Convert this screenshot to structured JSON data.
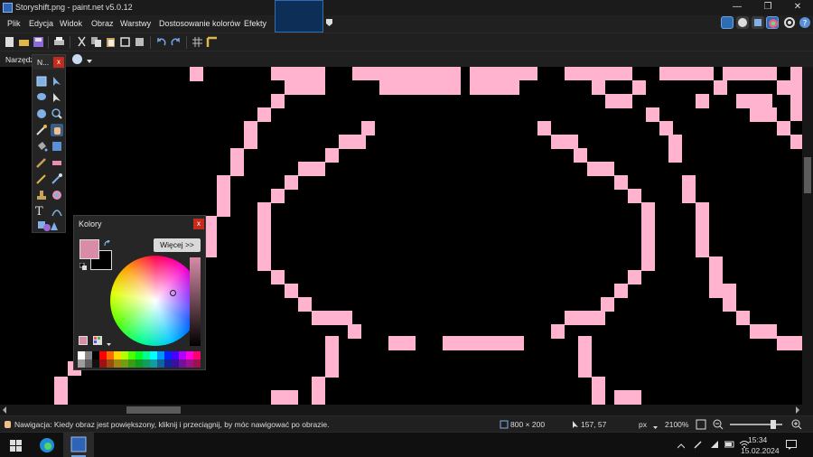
{
  "window": {
    "title": "Storyshift.png - paint.net v5.0.12",
    "min_glyph": "—",
    "max_glyph": "❐",
    "close_glyph": "✕"
  },
  "menu": {
    "items": [
      "Plik",
      "Edycja",
      "Widok",
      "Obraz",
      "Warstwy",
      "Dostosowanie kolorów",
      "Efekty"
    ]
  },
  "tools_option": {
    "label": "Narzędzie:"
  },
  "tools_panel": {
    "title": "N...",
    "close": "x",
    "text_tool_glyph": "T"
  },
  "colors_panel": {
    "title": "Kolory",
    "close": "x",
    "more_button": "Więcej >>",
    "primary_color": "#d88ca7",
    "secondary_color": "#000000"
  },
  "status": {
    "hint": "Nawigacja: Kiedy obraz jest powiększony, kliknij i przeciągnij, by móc nawigować po obrazie.",
    "image_size": "800 × 200",
    "cursor_pos": "157, 57",
    "units": "px",
    "zoom": "2100%"
  },
  "taskbar": {
    "time": "15:34",
    "date": "15.02.2024"
  },
  "colors": {
    "pink": "#ffb3cf",
    "accent": "#2f6db3"
  }
}
